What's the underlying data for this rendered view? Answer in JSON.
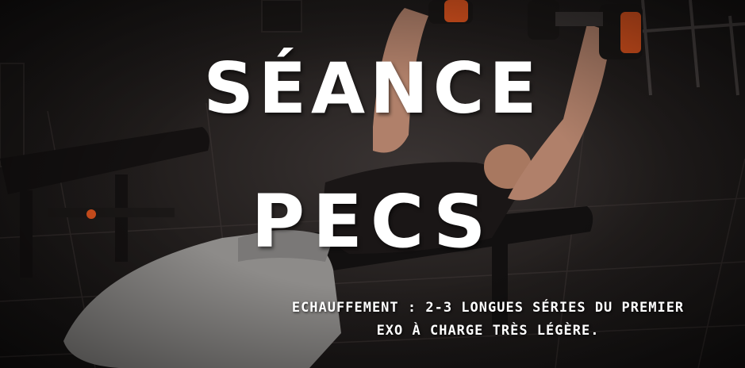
{
  "overlay": {
    "title_line_1": "SÉANCE",
    "title_line_2": "PECS",
    "subtitle_line_1": "ECHAUFFEMENT : 2-3 LONGUES SÉRIES DU PREMIER",
    "subtitle_line_2": "EXO À CHARGE TRÈS LÉGÈRE."
  },
  "colors": {
    "text": "#ffffff",
    "dumbbell_accent": "#e0551f",
    "floor": "#2a2524"
  }
}
